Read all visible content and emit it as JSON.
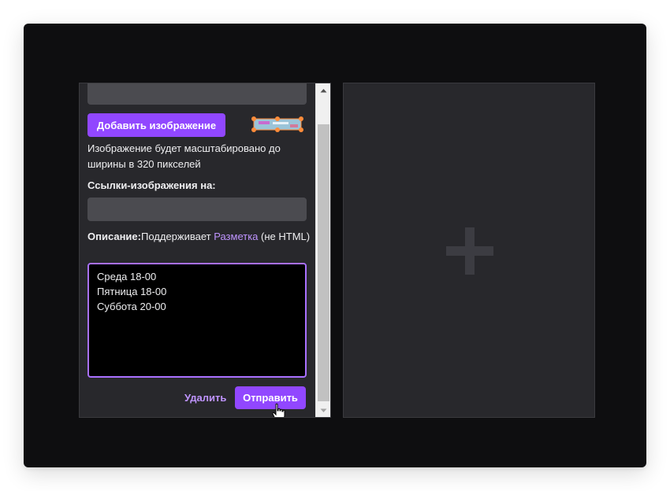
{
  "form": {
    "add_image_label": "Добавить изображение",
    "scale_note": "Изображение будет масштабировано до ширины в 320 пикселей",
    "links_label": "Ссылки-изображения на:",
    "description_label": "Описание:",
    "description_note_prefix": "Поддерживает ",
    "description_markup_link": "Разметка",
    "description_note_suffix": " (не HTML)",
    "description_lines": [
      "Среда 18-00",
      "Пятница 18-00",
      "Суббота 20-00"
    ],
    "delete_label": "Удалить",
    "submit_label": "Отправить"
  },
  "icons": {
    "image_thumbnail": "image-thumbnail-icon",
    "cursor": "hand-pointer-cursor",
    "add_panel": "plus-icon",
    "scroll_up": "scroll-up-arrow-icon",
    "scroll_down": "scroll-down-arrow-icon"
  },
  "colors": {
    "accent": "#9147ff",
    "link": "#bf94ff",
    "panel_bg": "#28282c",
    "window_bg": "#0e0e10",
    "input_bg": "#4b4b50",
    "focus_border": "#a970ff"
  }
}
